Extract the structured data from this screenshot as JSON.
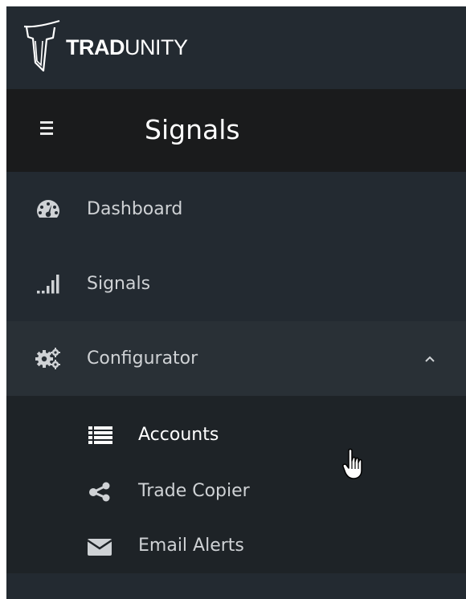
{
  "brand": {
    "name_bold": "TRAD",
    "name_light": "UNITY",
    "logo_icon": "tradunity-logo-icon"
  },
  "header": {
    "menu_icon": "hamburger-icon",
    "title": "Signals"
  },
  "sidebar": {
    "items": [
      {
        "label": "Dashboard",
        "icon": "dashboard-gauge-icon"
      },
      {
        "label": "Signals",
        "icon": "signal-bars-icon"
      },
      {
        "label": "Configurator",
        "icon": "cogs-icon",
        "expanded": true,
        "chevron": "chevron-up-icon"
      }
    ],
    "subitems": [
      {
        "label": "Accounts",
        "icon": "list-icon",
        "active": true
      },
      {
        "label": "Trade Copier",
        "icon": "share-icon"
      },
      {
        "label": "Email Alerts",
        "icon": "envelope-icon"
      }
    ]
  },
  "colors": {
    "sidebar_bg": "#232a31",
    "header_bg": "#1a1b1c",
    "expanded_bg": "#293036",
    "submenu_bg": "#1e2327",
    "text": "#cfd2d5",
    "text_active": "#ffffff"
  }
}
